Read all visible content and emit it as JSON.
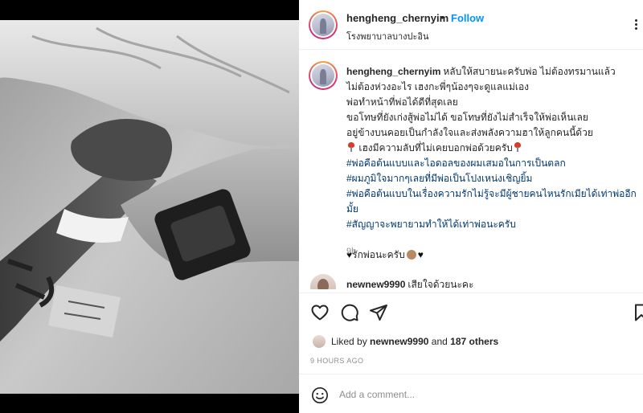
{
  "post": {
    "username": "hengheng_chernyim",
    "separator": "•",
    "follow_label": "Follow",
    "location": "โรงพยาบาลบางปะอิน"
  },
  "caption": {
    "username": "hengheng_chernyim",
    "line1": "หลับให้สบายนะครับพ่อ ไม่ต้องทรมานแล้ว",
    "lines": [
      "ไม่ต้องห่วงอะไร เฮงกะพี่ๆน้องๆจะดูแลแม่เอง",
      "พ่อทำหน้าที่พ่อได้ดีที่สุดเลย",
      "ขอโทษที่ยังเก่งสู้พ่อไม่ได้ ขอโทษที่ยังไม่สำเร็จให้พ่อเห็นเลย",
      "อยู่ข้างบนคอยเป็นกำลังใจและส่งพลังความฮาให้ลูกคนนี้ด้วย"
    ],
    "secret_line": "เฮงมีความลับที่ไม่เคยบอกพ่อด้วยครับ",
    "hashtags": [
      "#พ่อคือต้นแบบและไอดอลของผมเสมอในการเป็นตลก",
      "#ผมภูมิใจมากๆเลยที่มีพ่อเป็นโปงเหน่งเชิญยิ้ม",
      "#พ่อคือต้นแบบในเรื่องความรักไม่รู้จะมีผู้ชายคนไหนรักเมียได้เท่าพ่ออีก",
      "มั้ย",
      "#สัญญาจะพยายามทำให้ได้เท่าพ่อนะครับ"
    ],
    "love_line": "รักพ่อนะครับ",
    "time": "9h"
  },
  "comment": {
    "username": "newnew9990",
    "text": "เสียใจด้วยนะคะ"
  },
  "likes": {
    "prefix": "Liked by",
    "user": "newnew9990",
    "and": "and",
    "others": "187 others"
  },
  "posted_ago": "9 HOURS AGO",
  "add_comment": {
    "placeholder": "Add a comment..."
  },
  "icons": {
    "like": "heart-icon",
    "comment": "comment-icon",
    "share": "send-icon",
    "save": "bookmark-icon",
    "emoji": "smiley-icon",
    "more": "more-dots-icon"
  },
  "colors": {
    "follow": "#0095f6",
    "hashtag": "#00376b",
    "muted": "#8e8e8e"
  }
}
